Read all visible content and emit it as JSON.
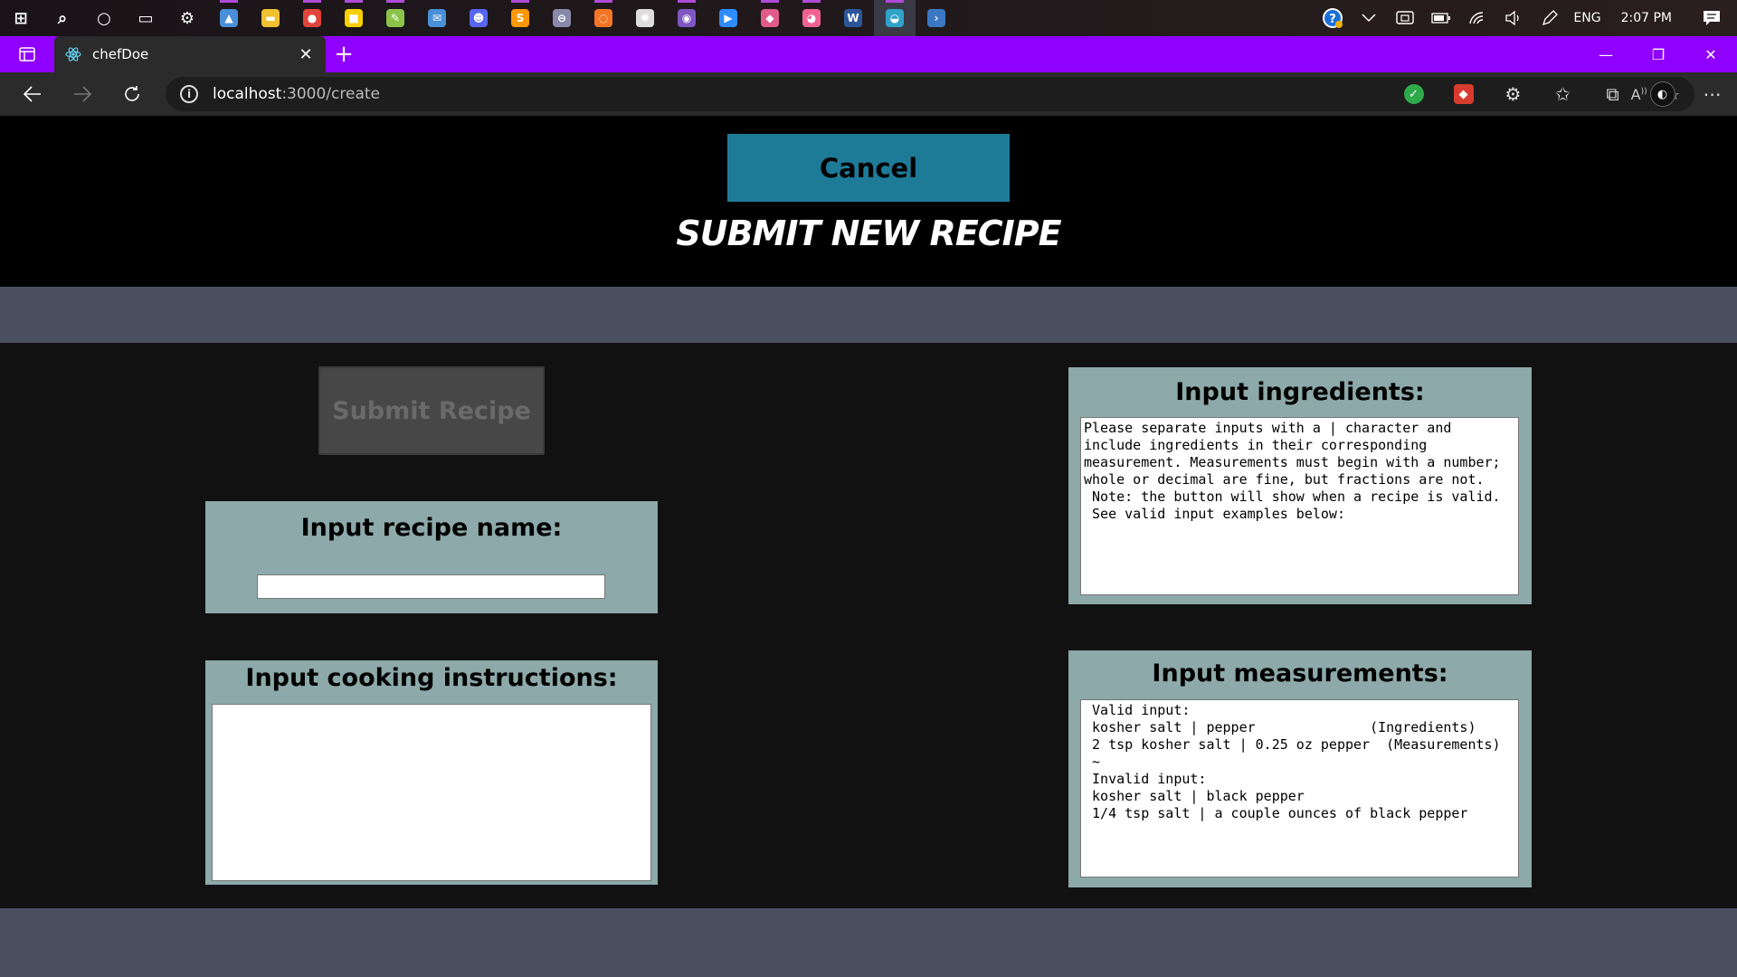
{
  "taskbar": {
    "icons": [
      {
        "name": "windows-start-icon",
        "color": "#ffffff"
      },
      {
        "name": "search-icon",
        "color": "#ffffff"
      },
      {
        "name": "cortana-icon",
        "color": "#ffffff"
      },
      {
        "name": "task-view-icon",
        "color": "#ffffff"
      },
      {
        "name": "settings-icon",
        "color": "#ffffff"
      },
      {
        "name": "photos-icon",
        "color": "#4a8fd8"
      },
      {
        "name": "file-explorer-icon",
        "color": "#f0c030"
      },
      {
        "name": "chrome-icon",
        "color": "#e0443a"
      },
      {
        "name": "sticky-notes-icon",
        "color": "#f8d000"
      },
      {
        "name": "notepad-plus-icon",
        "color": "#8bc34a"
      },
      {
        "name": "mail-icon",
        "color": "#4a90d8"
      },
      {
        "name": "discord-icon",
        "color": "#5865f2"
      },
      {
        "name": "sublime-text-icon",
        "color": "#ff9800"
      },
      {
        "name": "vpn-icon",
        "color": "#8888aa"
      },
      {
        "name": "jupyter-icon",
        "color": "#f37626"
      },
      {
        "name": "network-tool-icon",
        "color": "#dddddd"
      },
      {
        "name": "github-desktop-icon",
        "color": "#7e57c2"
      },
      {
        "name": "zoom-icon",
        "color": "#2d8cff"
      },
      {
        "name": "anaconda-icon",
        "color": "#e05a8a"
      },
      {
        "name": "paint-icon",
        "color": "#f06292"
      },
      {
        "name": "word-icon",
        "color": "#2b579a"
      },
      {
        "name": "edge-icon",
        "color": "#2fa3c9"
      },
      {
        "name": "powershell-icon",
        "color": "#3a78c4"
      }
    ],
    "running": [
      5,
      7,
      8,
      9,
      12,
      14,
      16,
      18,
      19,
      21
    ],
    "active_index": 21,
    "tray": {
      "language": "ENG",
      "time": "2:07 PM"
    }
  },
  "browser": {
    "tab_title": "chefDoe",
    "url_host": "localhost",
    "url_path": ":3000/create",
    "accent": "#9000ff"
  },
  "page": {
    "cancel_label": "Cancel",
    "title": "SUBMIT NEW RECIPE",
    "submit_label": "Submit Recipe",
    "recipe_name": {
      "heading": "Input recipe name:",
      "value": ""
    },
    "instructions": {
      "heading": "Input cooking instructions:",
      "value": ""
    },
    "ingredients": {
      "heading": "Input ingredients:",
      "value": "Please separate inputs with a | character and\ninclude ingredients in their corresponding\nmeasurement. Measurements must begin with a number;\nwhole or decimal are fine, but fractions are not.\n Note: the button will show when a recipe is valid.\n See valid input examples below:"
    },
    "measurements": {
      "heading": "Input measurements:",
      "value": " Valid input:\n kosher salt | pepper              (Ingredients)\n 2 tsp kosher salt | 0.25 oz pepper  (Measurements)\n ~\n Invalid input:\n kosher salt | black pepper\n 1/4 tsp salt | a couple ounces of black pepper"
    },
    "colors": {
      "header_bg": "#000000",
      "band": "#4a5060",
      "main_bg": "#111111",
      "panel": "#8da9aa",
      "cancel_bg": "#1e7b98",
      "submit_disabled_bg": "#474747"
    }
  }
}
